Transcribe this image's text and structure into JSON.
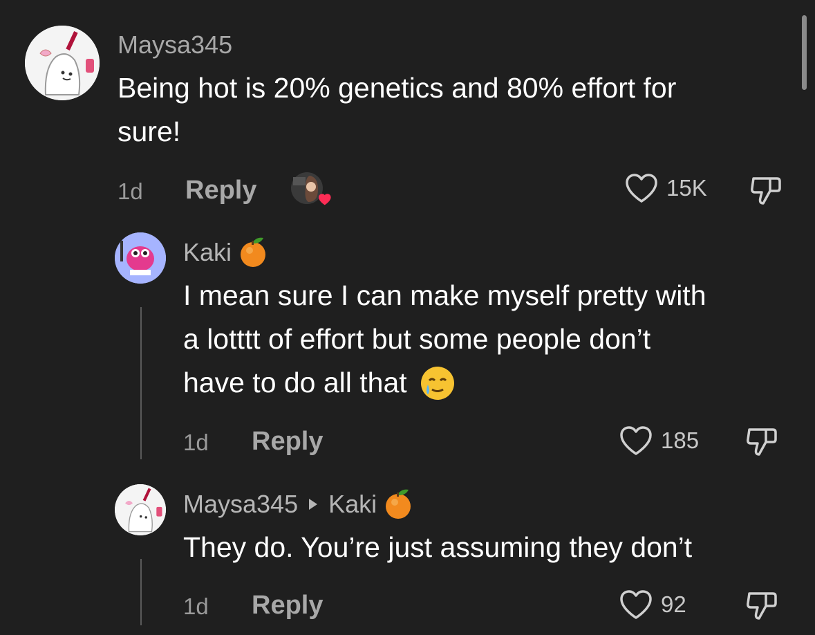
{
  "comments": [
    {
      "username": "Maysa345",
      "text_line1": "Being hot is 20% genetics and 80% effort for",
      "text_line2": "sure!",
      "time": "1d",
      "reply_label": "Reply",
      "likes": "15K",
      "liked_by_creator": true
    },
    {
      "username": "Kaki",
      "username_emoji": "orange-emoji",
      "text_line1": "I mean sure I can make myself pretty with",
      "text_line2": "a lotttt of effort but some people don’t",
      "text_line3": "have to do all that",
      "text_emoji": "crying-smile-emoji",
      "time": "1d",
      "reply_label": "Reply",
      "likes": "185"
    },
    {
      "username": "Maysa345",
      "reply_to": "Kaki",
      "reply_to_emoji": "orange-emoji",
      "text_line1": "They do. You’re just assuming they don’t",
      "time": "1d",
      "reply_label": "Reply",
      "likes": "92"
    }
  ],
  "colors": {
    "background": "#1f1f1f",
    "primary_text": "#ffffff",
    "secondary_text": "#a8a8a8",
    "heart_badge": "#fe2c55"
  }
}
